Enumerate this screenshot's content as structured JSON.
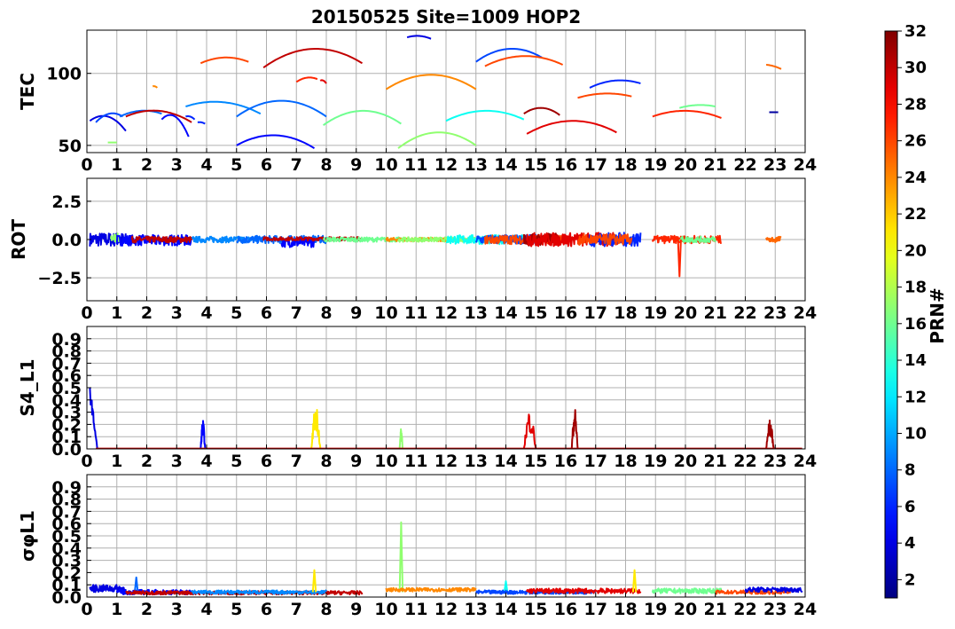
{
  "title": "20150525 Site=1009 HOP2",
  "colorbar": {
    "label": "PRN#",
    "min": 1,
    "max": 32,
    "ticks": [
      2,
      4,
      6,
      8,
      10,
      12,
      14,
      16,
      18,
      20,
      22,
      24,
      26,
      28,
      30,
      32
    ],
    "colormap": "jet"
  },
  "chart_data": [
    {
      "type": "line",
      "name": "tec",
      "ylabel": "TEC",
      "xlim": [
        0,
        24
      ],
      "ylim": [
        45,
        130
      ],
      "xticks": [
        0,
        1,
        2,
        3,
        4,
        5,
        6,
        7,
        8,
        9,
        10,
        11,
        12,
        13,
        14,
        15,
        16,
        17,
        18,
        19,
        20,
        21,
        22,
        23,
        24
      ],
      "yticks": [
        {
          "v": 50,
          "label": "50"
        },
        {
          "v": 100,
          "label": "100"
        }
      ],
      "grid": true,
      "series": [
        {
          "prn": 4,
          "kind": "arc",
          "x0": 0.1,
          "x1": 1.3,
          "y0": 67,
          "ypk": 70,
          "y1": 60
        },
        {
          "prn": 7,
          "kind": "arc",
          "x0": 0.3,
          "x1": 1.2,
          "y0": 66,
          "ypk": 72,
          "y1": 70
        },
        {
          "prn": 17,
          "kind": "arc",
          "x0": 0.7,
          "x1": 1.0,
          "y0": 52,
          "ypk": 52,
          "y1": 52
        },
        {
          "prn": 8,
          "kind": "arc",
          "x0": 1.1,
          "x1": 2.5,
          "y0": 70,
          "ypk": 74,
          "y1": 72
        },
        {
          "prn": 30,
          "kind": "arc",
          "x0": 1.3,
          "x1": 3.5,
          "y0": 70,
          "ypk": 74,
          "y1": 66
        },
        {
          "prn": 24,
          "kind": "arc",
          "x0": 2.2,
          "x1": 2.35,
          "y0": 91,
          "ypk": 91,
          "y1": 90
        },
        {
          "prn": 5,
          "kind": "arc",
          "x0": 2.5,
          "x1": 3.4,
          "y0": 68,
          "ypk": 70,
          "y1": 56
        },
        {
          "prn": 6,
          "kind": "arc",
          "x0": 3.3,
          "x1": 3.6,
          "y0": 70,
          "ypk": 70,
          "y1": 68
        },
        {
          "prn": 26,
          "kind": "arc",
          "x0": 3.8,
          "x1": 5.4,
          "y0": 107,
          "ypk": 111,
          "y1": 108
        },
        {
          "prn": 9,
          "kind": "arc",
          "x0": 3.3,
          "x1": 5.8,
          "y0": 77,
          "ypk": 80,
          "y1": 72
        },
        {
          "prn": 6,
          "kind": "arc",
          "x0": 3.7,
          "x1": 3.95,
          "y0": 66,
          "ypk": 66,
          "y1": 65
        },
        {
          "prn": 30,
          "kind": "arc",
          "x0": 5.9,
          "x1": 9.2,
          "y0": 104,
          "ypk": 117,
          "y1": 107
        },
        {
          "prn": 8,
          "kind": "arc",
          "x0": 5.0,
          "x1": 8.0,
          "y0": 70,
          "ypk": 81,
          "y1": 70
        },
        {
          "prn": 5,
          "kind": "arc",
          "x0": 5.0,
          "x1": 7.6,
          "y0": 50,
          "ypk": 57,
          "y1": 48
        },
        {
          "prn": 27,
          "kind": "arc",
          "x0": 7.0,
          "x1": 7.7,
          "y0": 94,
          "ypk": 97,
          "y1": 96
        },
        {
          "prn": 29,
          "kind": "arc",
          "x0": 7.8,
          "x1": 8.0,
          "y0": 95,
          "ypk": 95,
          "y1": 93
        },
        {
          "prn": 16,
          "kind": "arc",
          "x0": 7.9,
          "x1": 10.5,
          "y0": 64,
          "ypk": 74,
          "y1": 65
        },
        {
          "prn": 24,
          "kind": "arc",
          "x0": 10.0,
          "x1": 13.0,
          "y0": 89,
          "ypk": 99,
          "y1": 89
        },
        {
          "prn": 17,
          "kind": "arc",
          "x0": 10.4,
          "x1": 13.0,
          "y0": 48,
          "ypk": 59,
          "y1": 50
        },
        {
          "prn": 4,
          "kind": "arc",
          "x0": 10.7,
          "x1": 11.5,
          "y0": 125,
          "ypk": 126,
          "y1": 124
        },
        {
          "prn": 13,
          "kind": "arc",
          "x0": 12.0,
          "x1": 14.6,
          "y0": 67,
          "ypk": 74,
          "y1": 68
        },
        {
          "prn": 7,
          "kind": "arc",
          "x0": 13.0,
          "x1": 15.2,
          "y0": 108,
          "ypk": 117,
          "y1": 111
        },
        {
          "prn": 26,
          "kind": "arc",
          "x0": 13.3,
          "x1": 15.9,
          "y0": 105,
          "ypk": 112,
          "y1": 106
        },
        {
          "prn": 31,
          "kind": "arc",
          "x0": 14.6,
          "x1": 15.8,
          "y0": 72,
          "ypk": 76,
          "y1": 71
        },
        {
          "prn": 29,
          "kind": "arc",
          "x0": 14.7,
          "x1": 17.7,
          "y0": 58,
          "ypk": 67,
          "y1": 59
        },
        {
          "prn": 6,
          "kind": "arc",
          "x0": 16.8,
          "x1": 18.5,
          "y0": 90,
          "ypk": 95,
          "y1": 93
        },
        {
          "prn": 26,
          "kind": "arc",
          "x0": 16.4,
          "x1": 18.2,
          "y0": 83,
          "ypk": 86,
          "y1": 84
        },
        {
          "prn": 27,
          "kind": "arc",
          "x0": 18.9,
          "x1": 21.2,
          "y0": 70,
          "ypk": 74,
          "y1": 69
        },
        {
          "prn": 16,
          "kind": "arc",
          "x0": 19.8,
          "x1": 21.0,
          "y0": 76,
          "ypk": 78,
          "y1": 77
        },
        {
          "prn": 25,
          "kind": "arc",
          "x0": 22.7,
          "x1": 23.2,
          "y0": 106,
          "ypk": 105,
          "y1": 103
        },
        {
          "prn": 2,
          "kind": "arc",
          "x0": 22.8,
          "x1": 23.1,
          "y0": 73,
          "ypk": 73,
          "y1": 73
        }
      ]
    },
    {
      "type": "line",
      "name": "rot",
      "ylabel": "ROT",
      "xlim": [
        0,
        24
      ],
      "ylim": [
        -4,
        4
      ],
      "xticks": [
        0,
        1,
        2,
        3,
        4,
        5,
        6,
        7,
        8,
        9,
        10,
        11,
        12,
        13,
        14,
        15,
        16,
        17,
        18,
        19,
        20,
        21,
        22,
        23,
        24
      ],
      "yticks": [
        {
          "v": 2.5,
          "label": "2.5"
        },
        {
          "v": 0,
          "label": "0.0"
        },
        {
          "v": -2.5,
          "label": "−2.5"
        }
      ],
      "grid": true,
      "series": [
        {
          "prn": 4,
          "kind": "noise",
          "x0": 0.1,
          "x1": 1.3,
          "amp": 0.45,
          "base": 0.0
        },
        {
          "prn": 17,
          "kind": "noise",
          "x0": 0.8,
          "x1": 1.1,
          "amp": 0.3,
          "base": 0.1
        },
        {
          "prn": 5,
          "kind": "noise",
          "x0": 1.0,
          "x1": 3.5,
          "amp": 0.35,
          "base": -0.05
        },
        {
          "prn": 30,
          "kind": "noise",
          "x0": 1.5,
          "x1": 3.5,
          "amp": 0.2,
          "base": 0.0
        },
        {
          "prn": 9,
          "kind": "noise",
          "x0": 3.5,
          "x1": 5.8,
          "amp": 0.2,
          "base": 0.0
        },
        {
          "prn": 8,
          "kind": "noise",
          "x0": 5.0,
          "x1": 8.0,
          "amp": 0.25,
          "base": 0.0
        },
        {
          "prn": 5,
          "kind": "noise",
          "x0": 6.5,
          "x1": 7.6,
          "amp": 0.3,
          "base": -0.2
        },
        {
          "prn": 30,
          "kind": "noise",
          "x0": 5.9,
          "x1": 9.2,
          "amp": 0.12,
          "base": 0.05
        },
        {
          "prn": 16,
          "kind": "noise",
          "x0": 7.9,
          "x1": 10.5,
          "amp": 0.15,
          "base": 0.0
        },
        {
          "prn": 24,
          "kind": "noise",
          "x0": 10.0,
          "x1": 13.0,
          "amp": 0.12,
          "base": 0.0
        },
        {
          "prn": 17,
          "kind": "noise",
          "x0": 10.4,
          "x1": 13.0,
          "amp": 0.15,
          "base": 0.0
        },
        {
          "prn": 13,
          "kind": "noise",
          "x0": 12.0,
          "x1": 14.6,
          "amp": 0.3,
          "base": 0.0
        },
        {
          "prn": 7,
          "kind": "noise",
          "x0": 13.0,
          "x1": 15.2,
          "amp": 0.3,
          "base": 0.0
        },
        {
          "prn": 26,
          "kind": "noise",
          "x0": 13.3,
          "x1": 16.0,
          "amp": 0.3,
          "base": 0.0
        },
        {
          "prn": 31,
          "kind": "noise",
          "x0": 14.6,
          "x1": 15.8,
          "amp": 0.4,
          "base": 0.0
        },
        {
          "prn": 29,
          "kind": "noise",
          "x0": 14.7,
          "x1": 17.8,
          "amp": 0.45,
          "base": 0.0
        },
        {
          "prn": 6,
          "kind": "noise",
          "x0": 16.8,
          "x1": 18.5,
          "amp": 0.45,
          "base": 0.0
        },
        {
          "prn": 26,
          "kind": "noise",
          "x0": 16.4,
          "x1": 18.2,
          "amp": 0.35,
          "base": 0.0
        },
        {
          "prn": 27,
          "kind": "noise",
          "x0": 18.9,
          "x1": 21.2,
          "amp": 0.25,
          "base": 0.0
        },
        {
          "prn": 16,
          "kind": "noise",
          "x0": 19.8,
          "x1": 21.0,
          "amp": 0.2,
          "base": 0.0
        },
        {
          "prn": 27,
          "kind": "spike",
          "x": 19.8,
          "y": -2.4
        },
        {
          "prn": 25,
          "kind": "noise",
          "x0": 22.7,
          "x1": 23.2,
          "amp": 0.2,
          "base": 0.0
        }
      ]
    },
    {
      "type": "line",
      "name": "s4",
      "ylabel": "S4_L1",
      "xlim": [
        0,
        24
      ],
      "ylim": [
        0,
        1.0
      ],
      "xticks": [
        0,
        1,
        2,
        3,
        4,
        5,
        6,
        7,
        8,
        9,
        10,
        11,
        12,
        13,
        14,
        15,
        16,
        17,
        18,
        19,
        20,
        21,
        22,
        23,
        24
      ],
      "yticks": [
        {
          "v": 0,
          "label": "0.0"
        },
        {
          "v": 0.1,
          "label": "0.1"
        },
        {
          "v": 0.2,
          "label": "0.2"
        },
        {
          "v": 0.3,
          "label": "0.3"
        },
        {
          "v": 0.4,
          "label": "0.4"
        },
        {
          "v": 0.5,
          "label": "0.5"
        },
        {
          "v": 0.6,
          "label": "0.6"
        },
        {
          "v": 0.7,
          "label": "0.7"
        },
        {
          "v": 0.8,
          "label": "0.8"
        },
        {
          "v": 0.9,
          "label": "0.9"
        }
      ],
      "grid": true,
      "series": [
        {
          "prn": 4,
          "kind": "decay",
          "x0": 0.1,
          "x1": 0.35,
          "ypk": 0.47
        },
        {
          "prn": 5,
          "kind": "burst",
          "x0": 3.8,
          "x1": 3.95,
          "ypk": 0.24
        },
        {
          "prn": 21,
          "kind": "burst",
          "x0": 7.5,
          "x1": 7.8,
          "ypk": 0.37
        },
        {
          "prn": 17,
          "kind": "burst",
          "x0": 10.45,
          "x1": 10.55,
          "ypk": 0.17
        },
        {
          "prn": 29,
          "kind": "burst",
          "x0": 14.6,
          "x1": 15.0,
          "ypk": 0.32
        },
        {
          "prn": 31,
          "kind": "burst",
          "x0": 16.2,
          "x1": 16.4,
          "ypk": 0.34
        },
        {
          "prn": 31,
          "kind": "burst",
          "x0": 22.7,
          "x1": 22.95,
          "ypk": 0.24
        },
        {
          "prn": 30,
          "kind": "flat",
          "x0": 0.3,
          "x1": 23.9,
          "y": 0.003
        }
      ]
    },
    {
      "type": "line",
      "name": "sigphi",
      "ylabel": "σφL1",
      "xlim": [
        0,
        24
      ],
      "ylim": [
        0,
        1.0
      ],
      "xticks": [
        0,
        1,
        2,
        3,
        4,
        5,
        6,
        7,
        8,
        9,
        10,
        11,
        12,
        13,
        14,
        15,
        16,
        17,
        18,
        19,
        20,
        21,
        22,
        23,
        24
      ],
      "yticks": [
        {
          "v": 0,
          "label": "0.0"
        },
        {
          "v": 0.1,
          "label": "0.1"
        },
        {
          "v": 0.2,
          "label": "0.2"
        },
        {
          "v": 0.3,
          "label": "0.3"
        },
        {
          "v": 0.4,
          "label": "0.4"
        },
        {
          "v": 0.5,
          "label": "0.5"
        },
        {
          "v": 0.6,
          "label": "0.6"
        },
        {
          "v": 0.7,
          "label": "0.7"
        },
        {
          "v": 0.8,
          "label": "0.8"
        },
        {
          "v": 0.9,
          "label": "0.9"
        }
      ],
      "grid": true,
      "series": [
        {
          "prn": 4,
          "kind": "noise",
          "x0": 0.1,
          "x1": 1.3,
          "amp": 0.03,
          "base": 0.07
        },
        {
          "prn": 5,
          "kind": "noise",
          "x0": 1.0,
          "x1": 3.5,
          "amp": 0.02,
          "base": 0.04
        },
        {
          "prn": 8,
          "kind": "spike",
          "x": 1.65,
          "y": 0.16
        },
        {
          "prn": 30,
          "kind": "noise",
          "x0": 1.3,
          "x1": 9.2,
          "amp": 0.015,
          "base": 0.035
        },
        {
          "prn": 9,
          "kind": "noise",
          "x0": 3.5,
          "x1": 8.0,
          "amp": 0.015,
          "base": 0.04
        },
        {
          "prn": 21,
          "kind": "spike",
          "x": 7.6,
          "y": 0.22
        },
        {
          "prn": 17,
          "kind": "spike",
          "x": 10.5,
          "y": 0.61
        },
        {
          "prn": 24,
          "kind": "noise",
          "x0": 10.0,
          "x1": 13.0,
          "amp": 0.015,
          "base": 0.06
        },
        {
          "prn": 13,
          "kind": "spike",
          "x": 14.0,
          "y": 0.13
        },
        {
          "prn": 7,
          "kind": "noise",
          "x0": 13.0,
          "x1": 17.0,
          "amp": 0.015,
          "base": 0.04
        },
        {
          "prn": 29,
          "kind": "noise",
          "x0": 14.7,
          "x1": 18.5,
          "amp": 0.02,
          "base": 0.05
        },
        {
          "prn": 21,
          "kind": "spike",
          "x": 18.3,
          "y": 0.22
        },
        {
          "prn": 16,
          "kind": "noise",
          "x0": 18.9,
          "x1": 21.2,
          "amp": 0.02,
          "base": 0.05
        },
        {
          "prn": 26,
          "kind": "noise",
          "x0": 21.0,
          "x1": 23.5,
          "amp": 0.015,
          "base": 0.04
        },
        {
          "prn": 4,
          "kind": "noise",
          "x0": 22.0,
          "x1": 23.9,
          "amp": 0.02,
          "base": 0.06
        }
      ]
    }
  ]
}
